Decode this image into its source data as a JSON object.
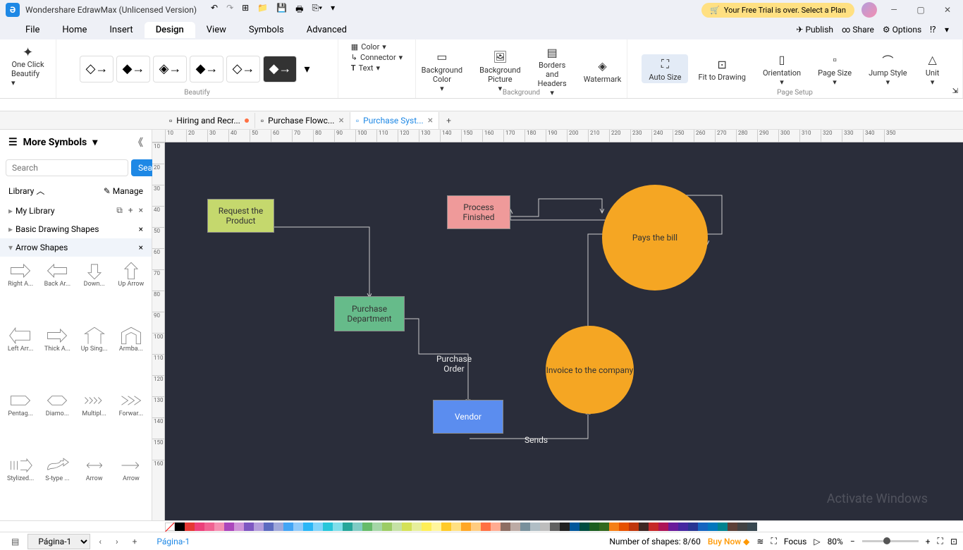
{
  "app": {
    "title": "Wondershare EdrawMax (Unlicensed Version)",
    "logo": "Ә",
    "trial_banner": "Your Free Trial is over. Select a Plan"
  },
  "menu": {
    "items": [
      "File",
      "Home",
      "Insert",
      "Design",
      "View",
      "Symbols",
      "Advanced"
    ],
    "active": "Design",
    "publish": "Publish",
    "share": "Share",
    "options": "Options"
  },
  "ribbon": {
    "beautify_title": "One Click",
    "beautify_sub": "Beautify",
    "beautify_label": "Beautify",
    "color": "Color",
    "connector": "Connector",
    "text": "Text",
    "bg_color": "Background Color",
    "bg_picture": "Background Picture",
    "borders": "Borders and Headers",
    "watermark": "Watermark",
    "background_label": "Background",
    "auto_size": "Auto Size",
    "fit_drawing": "Fit to Drawing",
    "orientation": "Orientation",
    "page_size": "Page Size",
    "jump_style": "Jump Style",
    "unit": "Unit",
    "page_setup_label": "Page Setup"
  },
  "tabs": [
    {
      "label": "Hiring and Recr...",
      "modified": true,
      "active": false
    },
    {
      "label": "Purchase Flowc...",
      "modified": false,
      "active": false
    },
    {
      "label": "Purchase Syst...",
      "modified": false,
      "active": true
    }
  ],
  "sidebar": {
    "more_symbols": "More Symbols",
    "search_placeholder": "Search",
    "search_btn": "Search",
    "library": "Library",
    "manage": "Manage",
    "my_library": "My Library",
    "basic_shapes": "Basic Drawing Shapes",
    "arrow_shapes": "Arrow Shapes",
    "shapes": [
      {
        "name": "Right A..."
      },
      {
        "name": "Back Ar..."
      },
      {
        "name": "Down..."
      },
      {
        "name": "Up Arrow"
      },
      {
        "name": "Left Arr..."
      },
      {
        "name": "Thick A..."
      },
      {
        "name": "Up Sing..."
      },
      {
        "name": "Armba..."
      },
      {
        "name": "Pentag..."
      },
      {
        "name": "Diamo..."
      },
      {
        "name": "Multipl..."
      },
      {
        "name": "Forwar..."
      },
      {
        "name": "Stylized..."
      },
      {
        "name": "S-type ..."
      },
      {
        "name": "Arrow"
      },
      {
        "name": "Arrow"
      }
    ]
  },
  "canvas": {
    "shapes": {
      "request": "Request the Product",
      "purchase_dept": "Purchase Department",
      "process_finished": "Process Finished",
      "pays_bill": "Pays the bill",
      "invoice": "Invoice to the company",
      "vendor": "Vendor",
      "po_label": "Purchase Order",
      "sends_label": "Sends"
    },
    "watermark1": "Activate Windows"
  },
  "status": {
    "page_options": "Página-1",
    "page_active": "Página-1",
    "shape_count": "Number of shapes: 8/60",
    "buy_now": "Buy Now",
    "focus": "Focus",
    "zoom": "80%"
  },
  "ruler_h": [
    "10",
    "20",
    "30",
    "40",
    "50",
    "60",
    "70",
    "80",
    "90",
    "100",
    "110",
    "120",
    "130",
    "140",
    "150",
    "160",
    "170",
    "180",
    "190",
    "200",
    "210",
    "220",
    "230",
    "240",
    "250",
    "260",
    "270",
    "280",
    "290",
    "300",
    "310",
    "320",
    "330",
    "340",
    "350"
  ],
  "ruler_v": [
    "10",
    "20",
    "30",
    "40",
    "50",
    "60",
    "70",
    "80",
    "90",
    "100",
    "110",
    "120",
    "130",
    "140",
    "150",
    "160"
  ],
  "colors": [
    "#000000",
    "#e53935",
    "#ec407a",
    "#f06292",
    "#f48fb1",
    "#ab47bc",
    "#ce93d8",
    "#7e57c2",
    "#b39ddb",
    "#5c6bc0",
    "#9fa8da",
    "#42a5f5",
    "#90caf9",
    "#29b6f6",
    "#81d4fa",
    "#26c6da",
    "#80deea",
    "#26a69a",
    "#80cbc4",
    "#66bb6a",
    "#a5d6a7",
    "#9ccc65",
    "#c5e1a5",
    "#d4e157",
    "#e6ee9c",
    "#ffee58",
    "#fff59d",
    "#ffca28",
    "#ffe082",
    "#ffa726",
    "#ffcc80",
    "#ff7043",
    "#ffab91",
    "#8d6e63",
    "#bcaaa4",
    "#78909c",
    "#b0bec5",
    "#bdbdbd",
    "#616161",
    "#212121",
    "#01579b",
    "#004d40",
    "#1b5e20",
    "#33691e",
    "#f57f17",
    "#e65100",
    "#bf360c",
    "#3e2723",
    "#c62828",
    "#ad1457",
    "#6a1b9a",
    "#4527a0",
    "#283593",
    "#1565c0",
    "#0277bd",
    "#00838f",
    "#5d4037",
    "#424242",
    "#37474f"
  ]
}
